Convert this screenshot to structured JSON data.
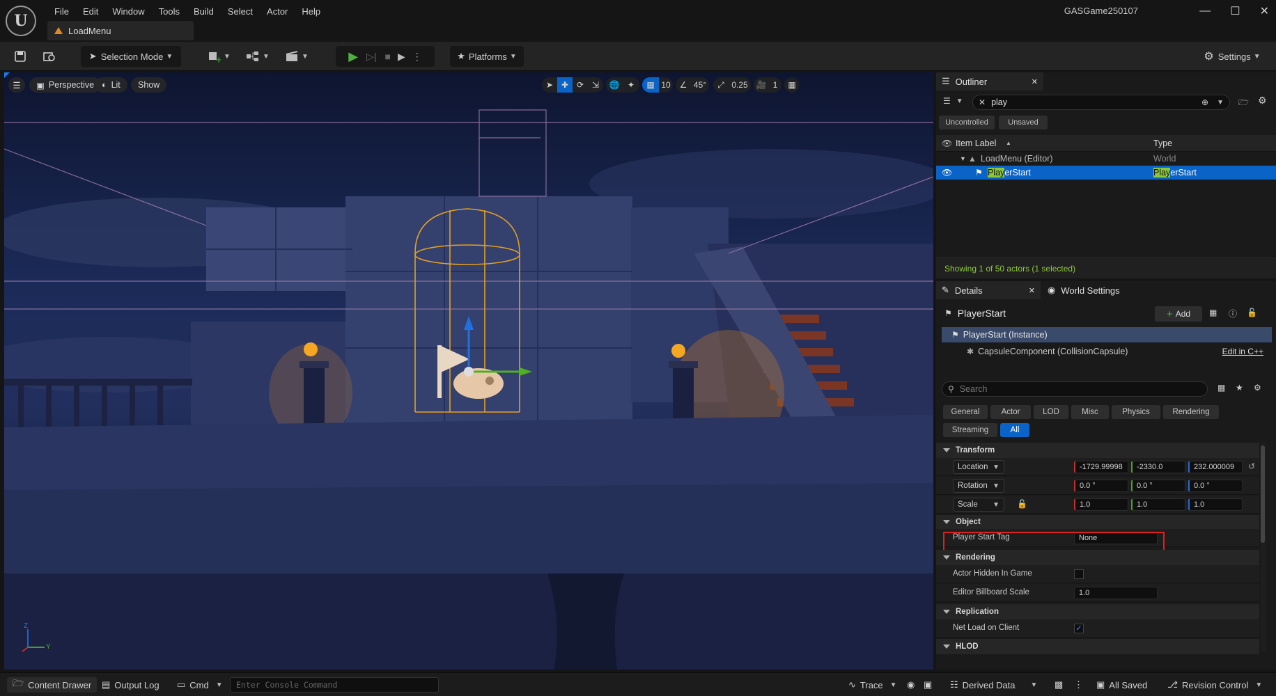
{
  "menu": [
    "File",
    "Edit",
    "Window",
    "Tools",
    "Build",
    "Select",
    "Actor",
    "Help"
  ],
  "doc_tab": "LoadMenu",
  "project_name": "GASGame250107",
  "toolbar": {
    "selection_mode": "Selection Mode",
    "platforms": "Platforms",
    "settings": "Settings"
  },
  "viewport": {
    "perspective": "Perspective",
    "lit": "Lit",
    "show": "Show",
    "grid_size": "10",
    "rotation_snap": "45°",
    "scale_snap": "0.25",
    "camera_speed": "1",
    "axis_z": "Z",
    "axis_y": "Y"
  },
  "outliner": {
    "tab": "Outliner",
    "search": "play",
    "filter_uncontrolled": "Uncontrolled",
    "filter_unsaved": "Unsaved",
    "col_label": "Item Label",
    "col_type": "Type",
    "rows": [
      {
        "label": "LoadMenu (Editor)",
        "type": "World"
      },
      {
        "label_hl": "Play",
        "label_rest": "erStart",
        "type_hl": "Play",
        "type_rest": "erStart"
      }
    ],
    "status": "Showing 1 of 50 actors (1 selected)"
  },
  "details": {
    "tab": "Details",
    "tab2": "World Settings",
    "actor": "PlayerStart",
    "add": "Add",
    "instance": "PlayerStart (Instance)",
    "component": "CapsuleComponent (CollisionCapsule)",
    "edit_cpp": "Edit in C++",
    "search_placeholder": "Search",
    "categories": [
      "General",
      "Actor",
      "LOD",
      "Misc",
      "Physics",
      "Rendering",
      "Streaming",
      "All"
    ],
    "sections": {
      "transform": "Transform",
      "object": "Object",
      "rendering": "Rendering",
      "replication": "Replication",
      "hlod": "HLOD"
    },
    "location": {
      "label": "Location",
      "x": "-1729.99998",
      "y": "-2330.0",
      "z": "232.000009"
    },
    "rotation": {
      "label": "Rotation",
      "x": "0.0 °",
      "y": "0.0 °",
      "z": "0.0 °"
    },
    "scale": {
      "label": "Scale",
      "x": "1.0",
      "y": "1.0",
      "z": "1.0"
    },
    "player_start_tag": {
      "label": "Player Start Tag",
      "value": "None"
    },
    "actor_hidden": {
      "label": "Actor Hidden In Game",
      "checked": false
    },
    "billboard_scale": {
      "label": "Editor Billboard Scale",
      "value": "1.0"
    },
    "net_load": {
      "label": "Net Load on Client",
      "checked": true
    }
  },
  "statusbar": {
    "content_drawer": "Content Drawer",
    "output_log": "Output Log",
    "cmd": "Cmd",
    "console_placeholder": "Enter Console Command",
    "trace": "Trace",
    "derived_data": "Derived Data",
    "all_saved": "All Saved",
    "revision_control": "Revision Control"
  },
  "colors": {
    "accent": "#0070e0",
    "selection": "#0a64c8",
    "highlight_box": "#e02020",
    "play_green": "#4caf3e"
  }
}
